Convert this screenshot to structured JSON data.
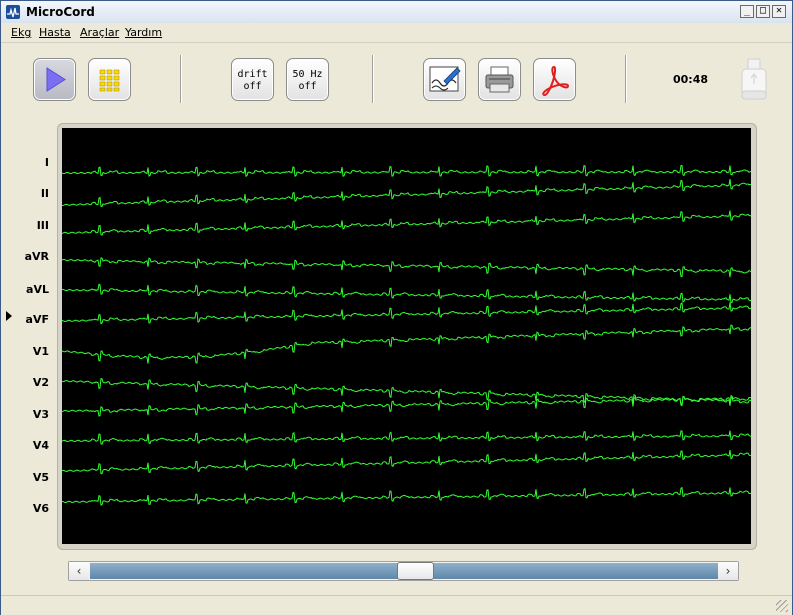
{
  "window": {
    "title": "MicroCord",
    "minimize": "_",
    "maximize": "□",
    "close": "✕"
  },
  "menu": [
    "Ekg",
    "Hasta",
    "Araçlar",
    "Yardım"
  ],
  "toolbar": {
    "drift": [
      "drift",
      "off"
    ],
    "filter": [
      "50 Hz",
      "off"
    ],
    "timer": "00:48"
  },
  "leads": [
    "I",
    "II",
    "III",
    "aVR",
    "aVL",
    "aVF",
    "V1",
    "V2",
    "V3",
    "V4",
    "V5",
    "V6"
  ],
  "scrollbar": {
    "left_arrow": "‹",
    "right_arrow": "›",
    "position": 0.52
  },
  "colors": {
    "trace": "#33ff33",
    "screen": "#000000",
    "play_arrow": "#7a6ff0",
    "pdf_red": "#e02020"
  }
}
